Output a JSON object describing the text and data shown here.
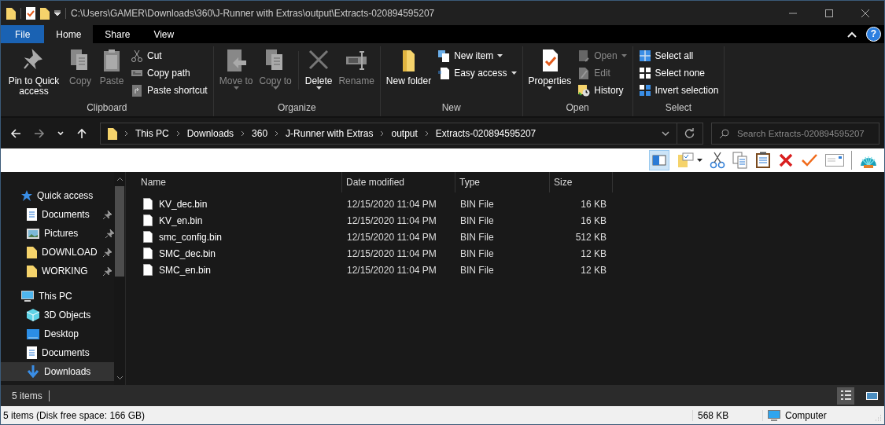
{
  "title_bar": {
    "path": "C:\\Users\\GAMER\\Downloads\\360\\J-Runner with Extras\\output\\Extracts-020894595207"
  },
  "ribbon": {
    "tabs": [
      {
        "label": "File",
        "selected": false,
        "kind": "file"
      },
      {
        "label": "Home",
        "selected": true,
        "kind": "tab"
      },
      {
        "label": "Share",
        "selected": false,
        "kind": "tab"
      },
      {
        "label": "View",
        "selected": false,
        "kind": "tab"
      }
    ],
    "help": "?",
    "groups": [
      {
        "name": "Clipboard",
        "commands": [
          {
            "label": "Pin to Quick access",
            "kind": "large",
            "dropdown": false,
            "disabled": false
          },
          {
            "label": "Copy",
            "kind": "large",
            "dropdown": false,
            "disabled": true
          },
          {
            "label": "Paste",
            "kind": "large",
            "dropdown": false,
            "disabled": true
          },
          {
            "label": "Cut",
            "kind": "small",
            "dropdown": false,
            "disabled": false
          },
          {
            "label": "Copy path",
            "kind": "small",
            "dropdown": false,
            "disabled": false
          },
          {
            "label": "Paste shortcut",
            "kind": "small",
            "dropdown": false,
            "disabled": false
          }
        ]
      },
      {
        "name": "Organize",
        "commands": [
          {
            "label": "Move to",
            "kind": "large",
            "dropdown": true,
            "disabled": true
          },
          {
            "label": "Copy to",
            "kind": "large",
            "dropdown": true,
            "disabled": true
          },
          {
            "label": "Delete",
            "kind": "large",
            "dropdown": true,
            "disabled": false
          },
          {
            "label": "Rename",
            "kind": "large",
            "dropdown": false,
            "disabled": true
          }
        ]
      },
      {
        "name": "New",
        "commands": [
          {
            "label": "New folder",
            "kind": "large",
            "dropdown": false,
            "disabled": false
          },
          {
            "label": "New item",
            "kind": "small",
            "dropdown": true,
            "disabled": false
          },
          {
            "label": "Easy access",
            "kind": "small",
            "dropdown": true,
            "disabled": false
          }
        ]
      },
      {
        "name": "Open",
        "commands": [
          {
            "label": "Properties",
            "kind": "large",
            "dropdown": true,
            "disabled": false
          },
          {
            "label": "Open",
            "kind": "small",
            "dropdown": true,
            "disabled": true
          },
          {
            "label": "Edit",
            "kind": "small",
            "dropdown": false,
            "disabled": true
          },
          {
            "label": "History",
            "kind": "small",
            "dropdown": false,
            "disabled": false
          }
        ]
      },
      {
        "name": "Select",
        "commands": [
          {
            "label": "Select all",
            "kind": "small",
            "dropdown": false,
            "disabled": false
          },
          {
            "label": "Select none",
            "kind": "small",
            "dropdown": false,
            "disabled": false
          },
          {
            "label": "Invert selection",
            "kind": "small",
            "dropdown": false,
            "disabled": false
          }
        ]
      }
    ]
  },
  "address": {
    "breadcrumbs": [
      "This PC",
      "Downloads",
      "360",
      "J-Runner with Extras",
      "output",
      "Extracts-020894595207"
    ],
    "search_placeholder": "Search Extracts-020894595207"
  },
  "sidebar": {
    "items": [
      {
        "label": "Quick access",
        "kind": "star",
        "selected": false,
        "children": [
          {
            "label": "Documents",
            "kind": "documents",
            "selected": false,
            "pinned": true
          },
          {
            "label": "Pictures",
            "kind": "pictures",
            "selected": false,
            "pinned": true
          },
          {
            "label": "DOWNLOAD",
            "kind": "folder",
            "selected": false,
            "pinned": true
          },
          {
            "label": "WORKING",
            "kind": "folder",
            "selected": false,
            "pinned": true
          }
        ]
      },
      {
        "label": "This PC",
        "kind": "pc",
        "selected": false,
        "children": [
          {
            "label": "3D Objects",
            "kind": "cube",
            "selected": false,
            "pinned": false
          },
          {
            "label": "Desktop",
            "kind": "desktop",
            "selected": false,
            "pinned": false
          },
          {
            "label": "Documents",
            "kind": "documents",
            "selected": false,
            "pinned": false
          },
          {
            "label": "Downloads",
            "kind": "downloads",
            "selected": true,
            "pinned": false
          }
        ]
      }
    ]
  },
  "table": {
    "columns": [
      "Name",
      "Date modified",
      "Type",
      "Size"
    ],
    "rows": [
      {
        "name": "KV_dec.bin",
        "date": "12/15/2020 11:04 PM",
        "type": "BIN File",
        "size": "16 KB"
      },
      {
        "name": "KV_en.bin",
        "date": "12/15/2020 11:04 PM",
        "type": "BIN File",
        "size": "16 KB"
      },
      {
        "name": "smc_config.bin",
        "date": "12/15/2020 11:04 PM",
        "type": "BIN File",
        "size": "512 KB"
      },
      {
        "name": "SMC_dec.bin",
        "date": "12/15/2020 11:04 PM",
        "type": "BIN File",
        "size": "12 KB"
      },
      {
        "name": "SMC_en.bin",
        "date": "12/15/2020 11:04 PM",
        "type": "BIN File",
        "size": "12 KB"
      }
    ]
  },
  "status_bar": {
    "count": "5 items",
    "views": [
      {
        "kind": "details",
        "selected": true
      },
      {
        "kind": "tiles",
        "selected": false
      }
    ]
  },
  "bottom_bar": {
    "summary": "5 items (Disk free space: 166 GB)",
    "size": "568 KB",
    "location": "Computer"
  }
}
